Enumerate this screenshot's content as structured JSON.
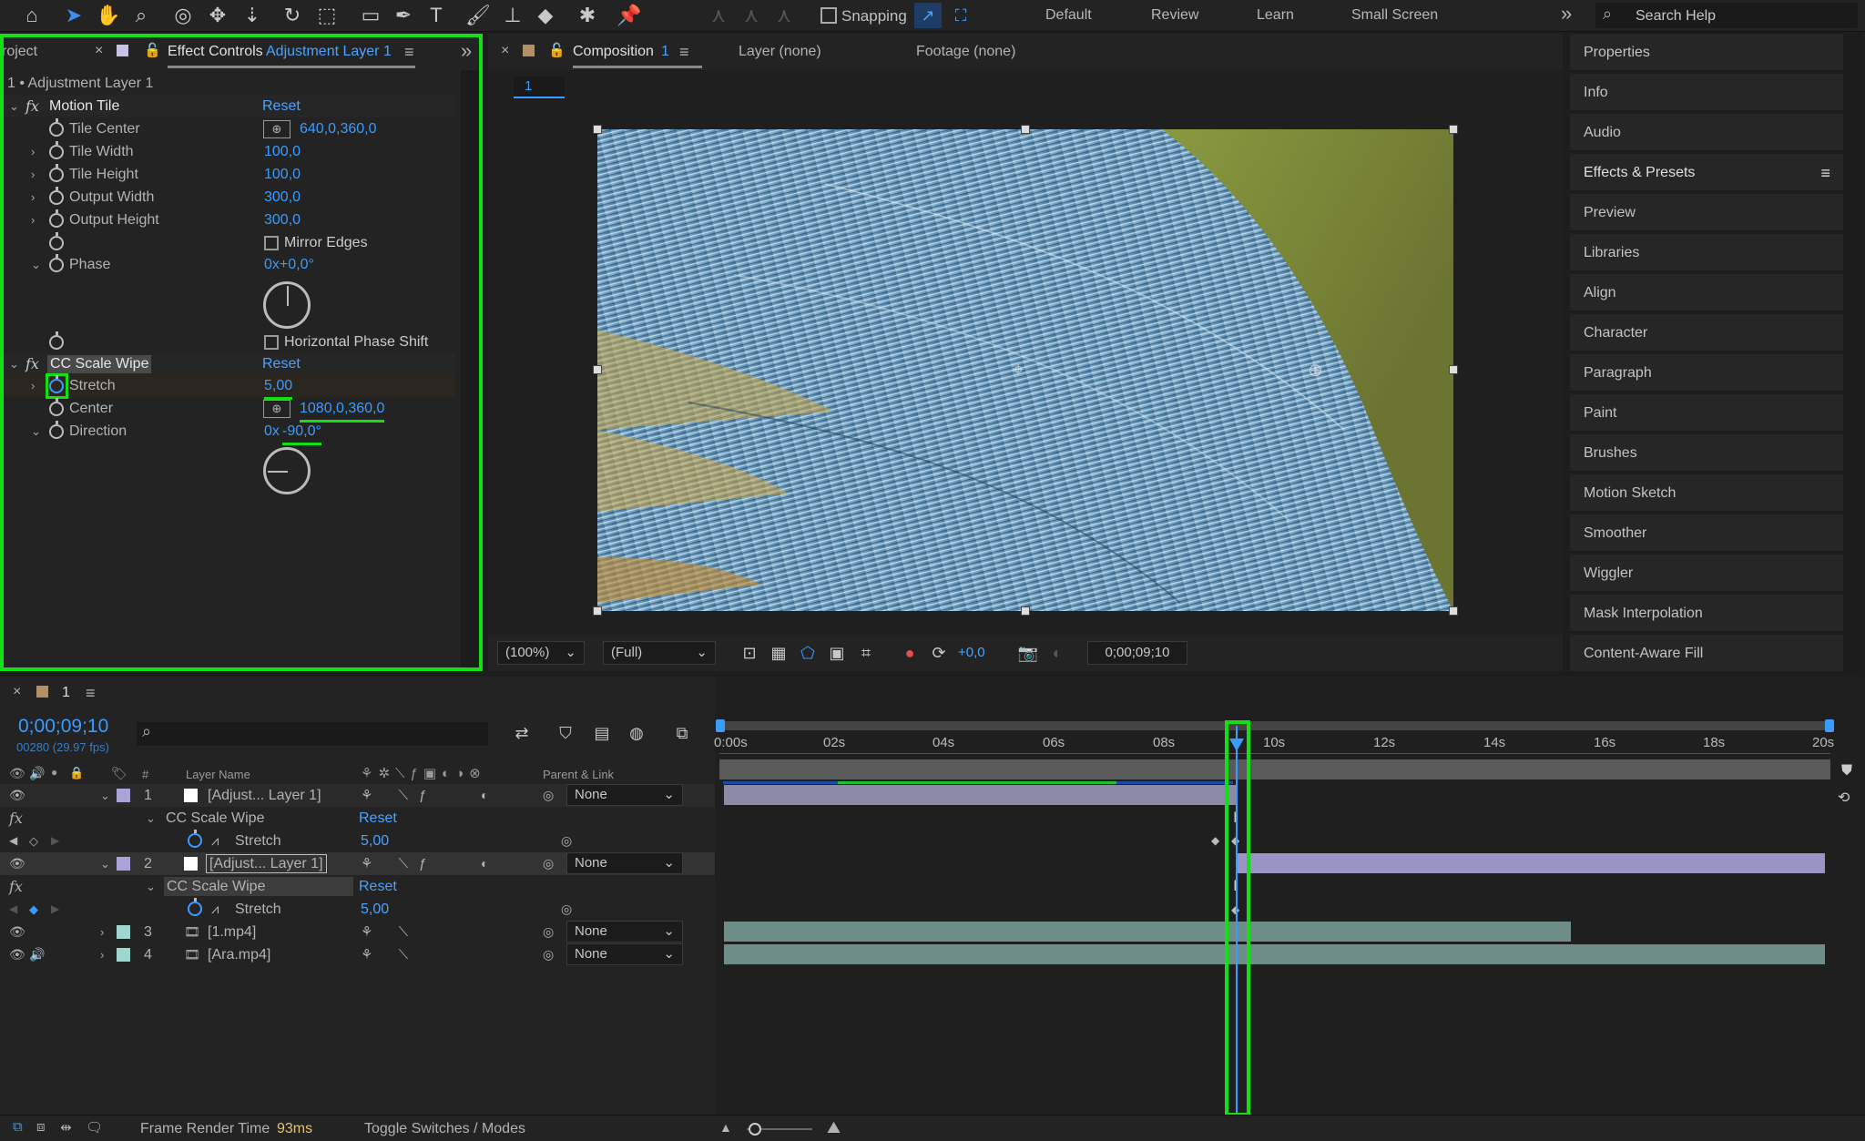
{
  "toolbar": {
    "snapping_label": "Snapping",
    "workspaces": [
      "Default",
      "Review",
      "Learn",
      "Small Screen"
    ],
    "search_placeholder": "Search Help",
    "more": "»"
  },
  "left_panel": {
    "project_tab": "roject",
    "close_glyph": "×",
    "effect_controls_tab": "Effect Controls",
    "layer_link": "Adjustment Layer 1",
    "menu_glyph": "≡",
    "expand_glyph": "»",
    "breadcrumb": "1 • Adjustment Layer 1",
    "motion_tile": {
      "name": "Motion Tile",
      "reset": "Reset",
      "tile_center_label": "Tile Center",
      "tile_center_value": "640,0,360,0",
      "tile_width_label": "Tile Width",
      "tile_width_value": "100,0",
      "tile_height_label": "Tile Height",
      "tile_height_value": "100,0",
      "output_width_label": "Output Width",
      "output_width_value": "300,0",
      "output_height_label": "Output Height",
      "output_height_value": "300,0",
      "mirror_edges_label": "Mirror Edges",
      "phase_label": "Phase",
      "phase_value": "0x+0,0°",
      "horizontal_phase_label": "Horizontal Phase Shift"
    },
    "cc_scale_wipe": {
      "name": "CC Scale Wipe",
      "reset": "Reset",
      "stretch_label": "Stretch",
      "stretch_value": "5,00",
      "center_label": "Center",
      "center_value": "1080,0,360,0",
      "direction_label": "Direction",
      "direction_prefix": "0x",
      "direction_value": "-90,0°"
    }
  },
  "comp_panel": {
    "close_glyph": "×",
    "tab": "Composition",
    "tab_num": "1",
    "menu_glyph": "≡",
    "layer_tab": "Layer (none)",
    "footage_tab": "Footage (none)",
    "sub_tab": "1",
    "zoom": "(100%)",
    "resolution": "(Full)",
    "exposure": "+0,0",
    "timecode": "0;00;09;10"
  },
  "right_panel": {
    "items": [
      "Properties",
      "Info",
      "Audio",
      "Effects & Presets",
      "Preview",
      "Libraries",
      "Align",
      "Character",
      "Paragraph",
      "Paint",
      "Brushes",
      "Motion Sketch",
      "Smoother",
      "Wiggler",
      "Mask Interpolation",
      "Content-Aware Fill"
    ],
    "menu_glyph": "≡"
  },
  "timeline": {
    "close_glyph": "×",
    "tab": "1",
    "menu_glyph": "≡",
    "timecode": "0;00;09;10",
    "frame_info": "00280 (29.97 fps)",
    "col_hash": "#",
    "col_layer_name": "Layer Name",
    "col_parent": "Parent & Link",
    "ruler": [
      "0:00s",
      "02s",
      "04s",
      "06s",
      "08s",
      "10s",
      "12s",
      "14s",
      "16s",
      "18s",
      "20s"
    ],
    "layers": [
      {
        "num": "1",
        "name": "[Adjust... Layer 1]",
        "parent": "None"
      },
      {
        "num": "2",
        "name": "[Adjust... Layer 1]",
        "parent": "None"
      },
      {
        "num": "3",
        "name": "[1.mp4]",
        "parent": "None"
      },
      {
        "num": "4",
        "name": "[Ara.mp4]",
        "parent": "None"
      }
    ],
    "effect_name": "CC Scale Wipe",
    "reset": "Reset",
    "stretch_label": "Stretch",
    "stretch_value": "5,00"
  },
  "status_bar": {
    "frame_render_label": "Frame Render Time",
    "frame_render_value": "93ms",
    "toggle": "Toggle Switches / Modes"
  },
  "colors": {
    "accent_blue": "#3a9cff",
    "highlight_green": "#13e013",
    "adjustment_bar": "#8d8aa8",
    "video_bar": "#6e8c88"
  },
  "playhead_fraction": 0.465
}
